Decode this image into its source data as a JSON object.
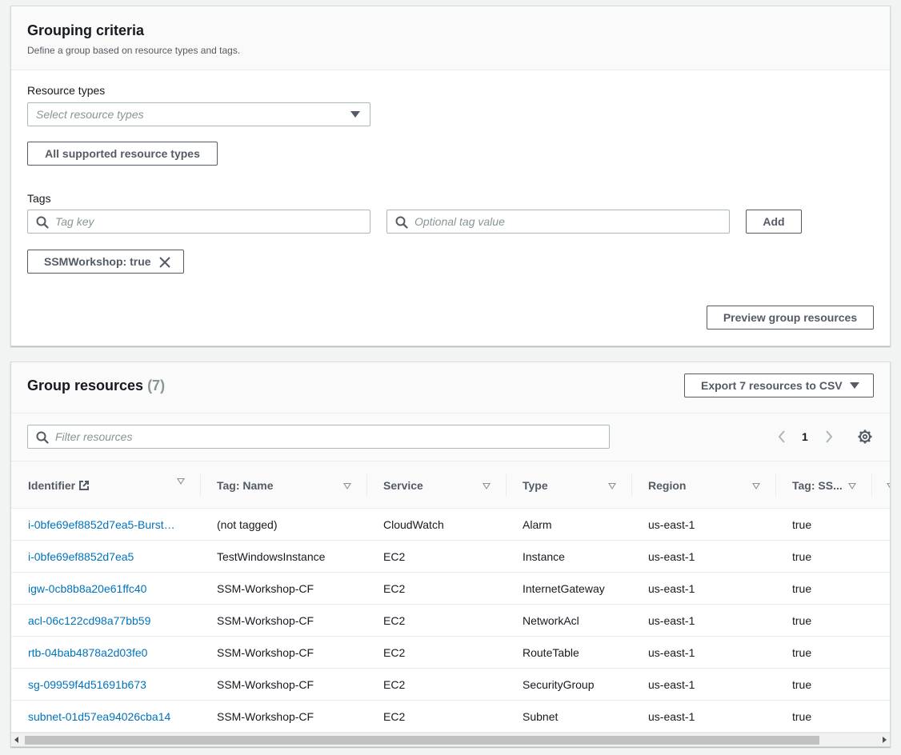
{
  "criteria": {
    "title": "Grouping criteria",
    "description": "Define a group based on resource types and tags.",
    "resource_types_label": "Resource types",
    "resource_types_placeholder": "Select resource types",
    "all_types_button": "All supported resource types",
    "tags_label": "Tags",
    "tag_key_placeholder": "Tag key",
    "tag_value_placeholder": "Optional tag value",
    "add_button": "Add",
    "token": "SSMWorkshop: true",
    "preview_button": "Preview group resources"
  },
  "resources": {
    "title": "Group resources",
    "count": "(7)",
    "export_button": "Export 7 resources to CSV",
    "filter_placeholder": "Filter resources",
    "page": "1",
    "columns": [
      "Identifier",
      "Tag: Name",
      "Service",
      "Type",
      "Region",
      "Tag: SS..."
    ],
    "rows": [
      [
        "i-0bfe69ef8852d7ea5-Burst…",
        "(not tagged)",
        "CloudWatch",
        "Alarm",
        "us-east-1",
        "true"
      ],
      [
        "i-0bfe69ef8852d7ea5",
        "TestWindowsInstance",
        "EC2",
        "Instance",
        "us-east-1",
        "true"
      ],
      [
        "igw-0cb8b8a20e61ffc40",
        "SSM-Workshop-CF",
        "EC2",
        "InternetGateway",
        "us-east-1",
        "true"
      ],
      [
        "acl-06c122cd98a77bb59",
        "SSM-Workshop-CF",
        "EC2",
        "NetworkAcl",
        "us-east-1",
        "true"
      ],
      [
        "rtb-04bab4878a2d03fe0",
        "SSM-Workshop-CF",
        "EC2",
        "RouteTable",
        "us-east-1",
        "true"
      ],
      [
        "sg-09959f4d51691b673",
        "SSM-Workshop-CF",
        "EC2",
        "SecurityGroup",
        "us-east-1",
        "true"
      ],
      [
        "subnet-01d57ea94026cba14",
        "SSM-Workshop-CF",
        "EC2",
        "Subnet",
        "us-east-1",
        "true"
      ]
    ]
  },
  "icons": [
    "caret-down-icon",
    "search-icon",
    "close-icon",
    "external-link-icon",
    "sort-icon",
    "chevron-left-icon",
    "chevron-right-icon",
    "gear-icon"
  ],
  "colors": {
    "link": "#0073bb",
    "text": "#16191f",
    "muted": "#545b64",
    "background": "#f2f3f3"
  }
}
